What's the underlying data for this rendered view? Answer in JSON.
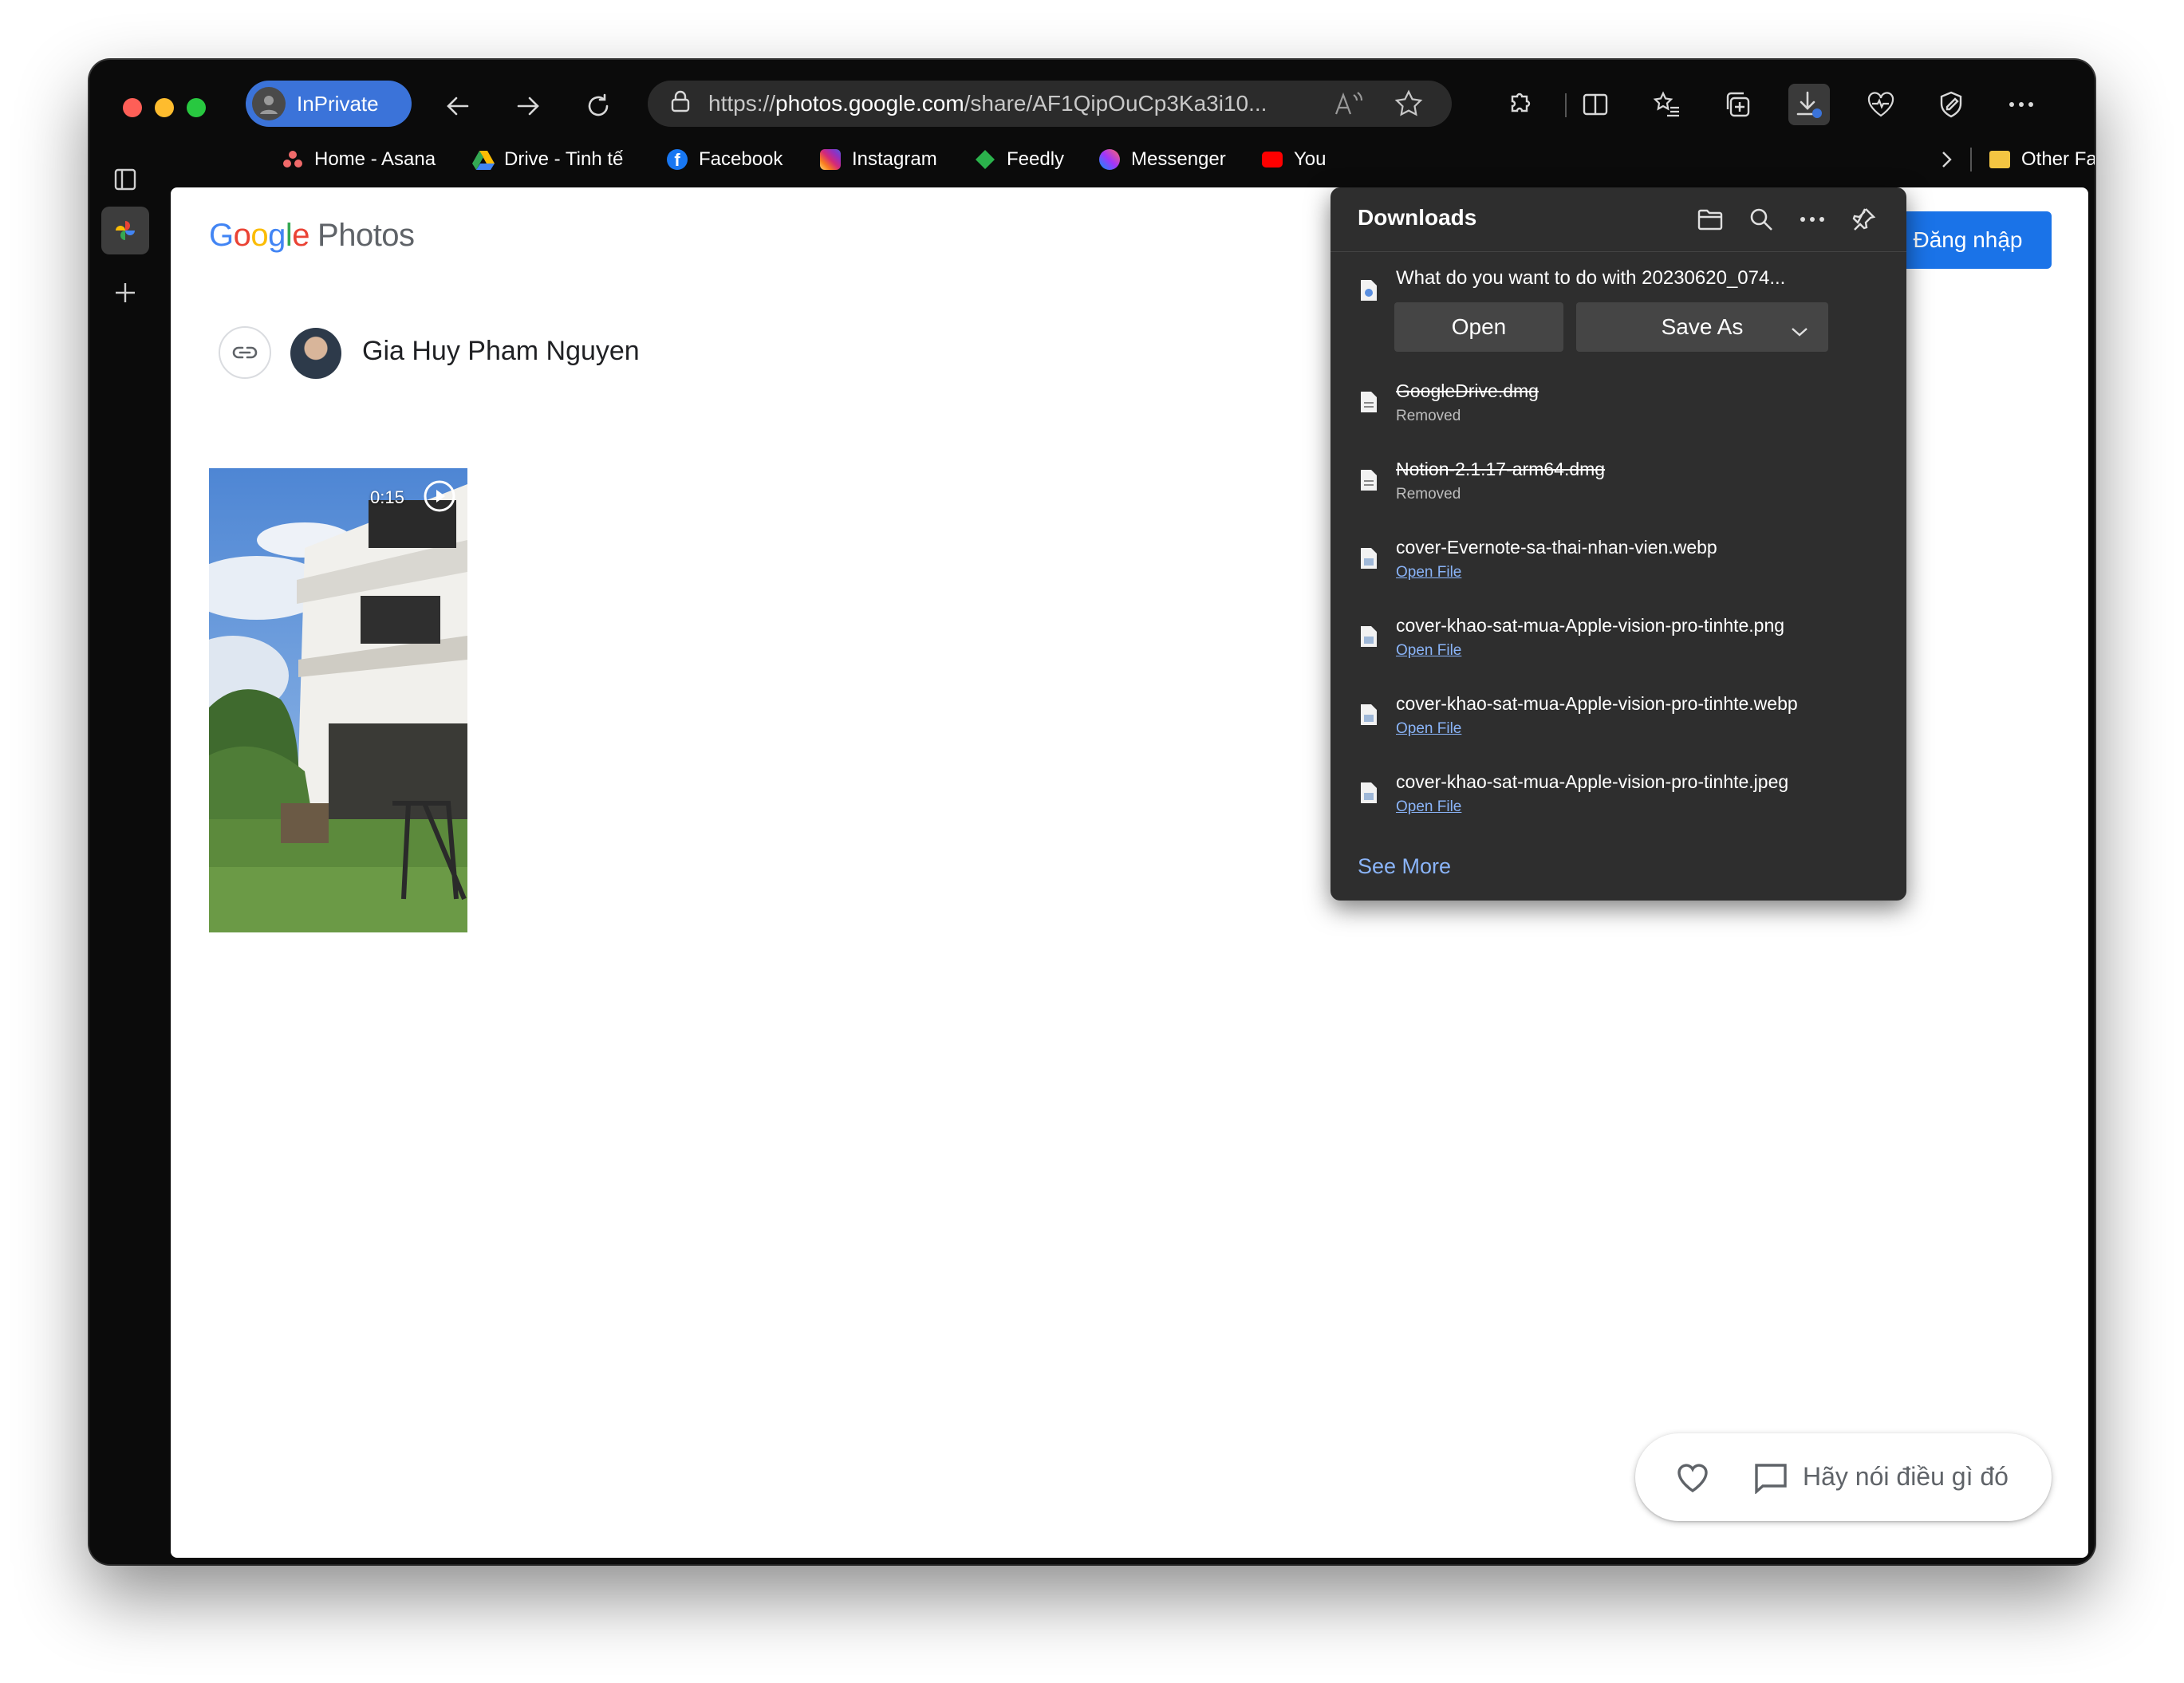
{
  "browser": {
    "profile_label": "InPrivate",
    "url_scheme": "https://",
    "url_host": "photos.google.com",
    "url_path": "/share/AF1QipOuCp3Ka3i10..."
  },
  "bookmarks": [
    "Home - Asana",
    "Drive - Tinh tế",
    "Facebook",
    "Instagram",
    "Feedly",
    "Messenger",
    "You",
    "Other Favorites"
  ],
  "page": {
    "logo_google": "Google",
    "logo_photos": "Photos",
    "signin_label": "Đăng nhập",
    "owner_name": "Gia Huy Pham Nguyen",
    "video_duration": "0:15",
    "comment_placeholder": "Hãy nói điều gì đó"
  },
  "downloads": {
    "title": "Downloads",
    "prompt": "What do you want to do with 20230620_074...",
    "open_label": "Open",
    "save_as_label": "Save As",
    "items": [
      {
        "name": "GoogleDrive.dmg",
        "status": "Removed"
      },
      {
        "name": "Notion-2.1.17-arm64.dmg",
        "status": "Removed"
      },
      {
        "name": "cover-Evernote-sa-thai-nhan-vien.webp",
        "status": "Open File"
      },
      {
        "name": "cover-khao-sat-mua-Apple-vision-pro-tinhte.png",
        "status": "Open File"
      },
      {
        "name": "cover-khao-sat-mua-Apple-vision-pro-tinhte.webp",
        "status": "Open File"
      },
      {
        "name": "cover-khao-sat-mua-Apple-vision-pro-tinhte.jpeg",
        "status": "Open File"
      }
    ],
    "see_more": "See More"
  },
  "colors": {
    "accent": "#1a73e8",
    "inprivate": "#3b73d9",
    "link": "#8ab4f8"
  }
}
